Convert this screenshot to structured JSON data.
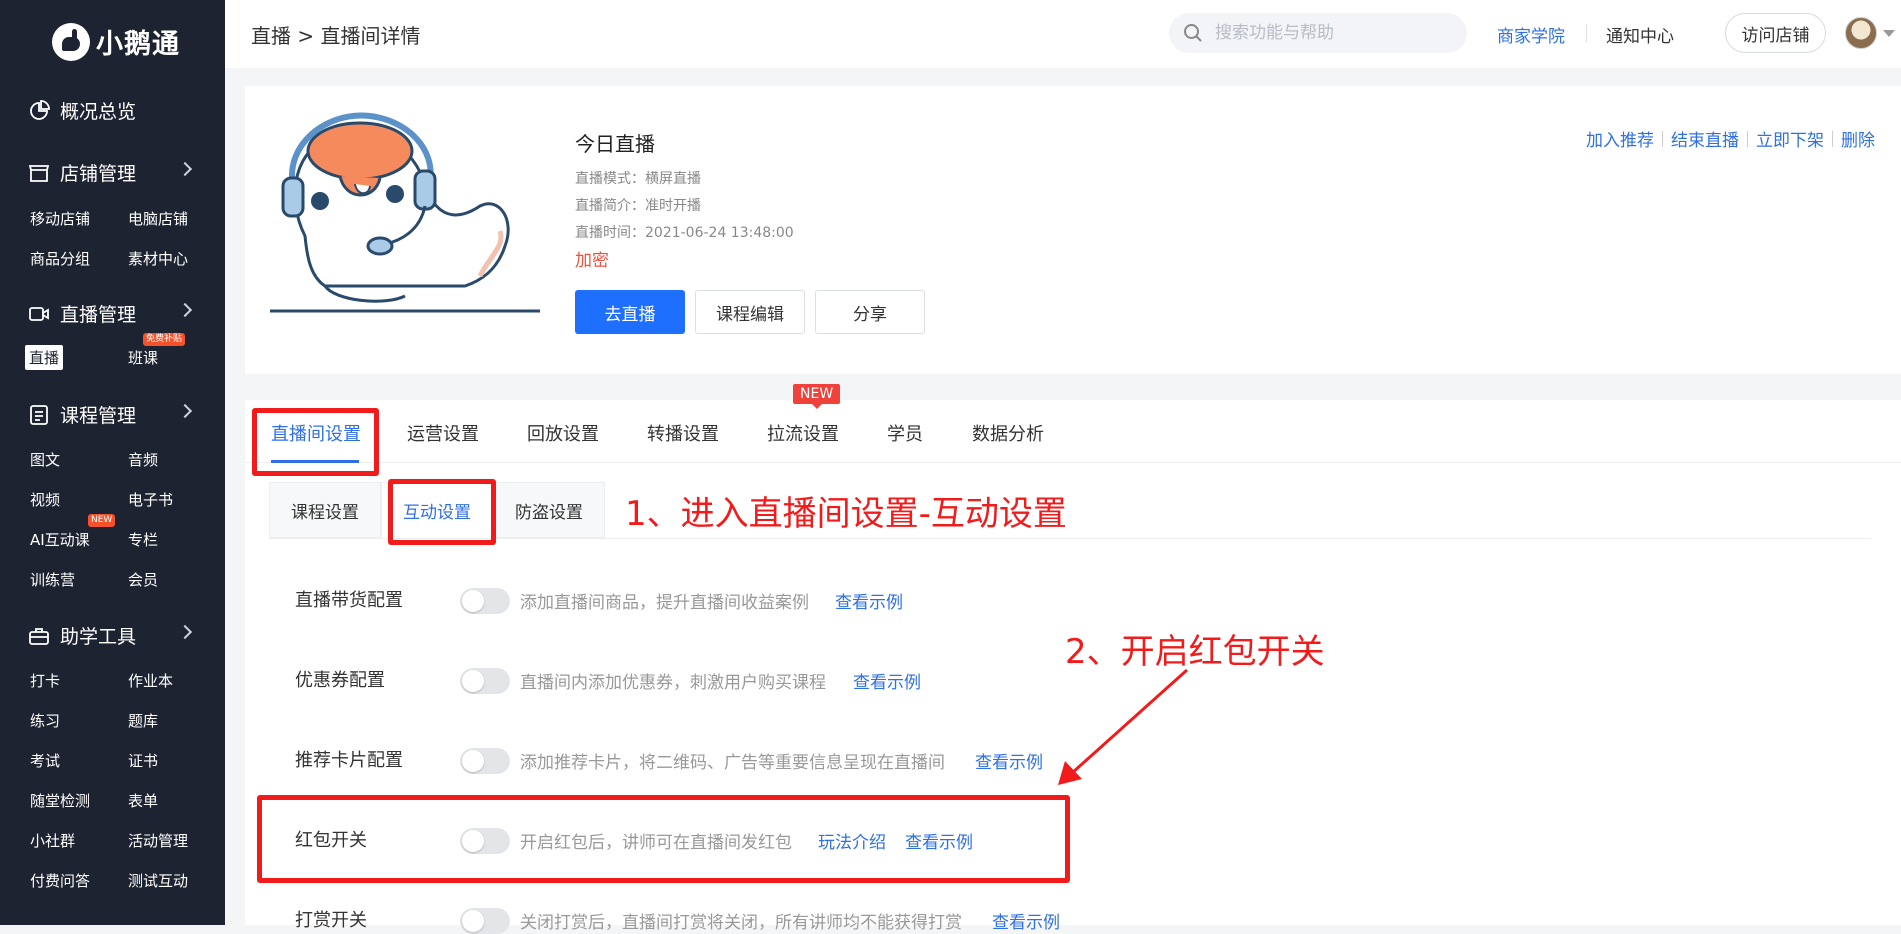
{
  "sidebar": {
    "logo_text": "小鹅通",
    "groups": [
      {
        "label": "概况总览"
      },
      {
        "label": "店铺管理",
        "items": [
          "移动店铺",
          "电脑店铺",
          "商品分组",
          "素材中心"
        ]
      },
      {
        "label": "直播管理",
        "items": [
          "直播",
          "班课"
        ],
        "badge": "免费补贴"
      },
      {
        "label": "课程管理",
        "items": [
          "图文",
          "音频",
          "视频",
          "电子书",
          "AI互动课",
          "专栏",
          "训练营",
          "会员"
        ],
        "badge": "NEW"
      },
      {
        "label": "助学工具",
        "items": [
          "打卡",
          "作业本",
          "练习",
          "题库",
          "考试",
          "证书",
          "随堂检测",
          "表单",
          "小社群",
          "活动管理",
          "付费问答",
          "测试互动"
        ]
      }
    ]
  },
  "topbar": {
    "breadcrumb": "直播 > 直播间详情",
    "search_placeholder": "搜索功能与帮助",
    "links": [
      "商家学院",
      "通知中心"
    ],
    "visit_store": "访问店铺"
  },
  "live": {
    "title": "今日直播",
    "mode": "直播模式：横屏直播",
    "intro": "直播简介：准时开播",
    "time": "直播时间：2021-06-24 13:48:00",
    "lock": "加密",
    "buttons": {
      "go_live": "去直播",
      "course_edit": "课程编辑",
      "share": "分享"
    },
    "actions": [
      "加入推荐",
      "结束直播",
      "立即下架",
      "删除"
    ]
  },
  "tabs": {
    "items": [
      "直播间设置",
      "运营设置",
      "回放设置",
      "转播设置",
      "拉流设置",
      "学员",
      "数据分析"
    ],
    "new_badge": "NEW"
  },
  "subtabs": [
    "课程设置",
    "互动设置",
    "防盗设置"
  ],
  "settings_rows": [
    {
      "label": "直播带货配置",
      "desc": "添加直播间商品，提升直播间收益案例",
      "links": [
        "查看示例"
      ]
    },
    {
      "label": "优惠券配置",
      "desc": "直播间内添加优惠券，刺激用户购买课程",
      "links": [
        "查看示例"
      ]
    },
    {
      "label": "推荐卡片配置",
      "desc": "添加推荐卡片，将二维码、广告等重要信息呈现在直播间",
      "links": [
        "查看示例"
      ]
    },
    {
      "label": "红包开关",
      "desc": "开启红包后，讲师可在直播间发红包",
      "links": [
        "玩法介绍",
        "查看示例"
      ]
    },
    {
      "label": "打赏开关",
      "desc": "关闭打赏后，直播间打赏将关闭，所有讲师均不能获得打赏",
      "links": [
        "查看示例"
      ]
    }
  ],
  "annotations": {
    "step1": "1、进入直播间设置-互动设置",
    "step2": "2、开启红包开关"
  },
  "colors": {
    "accent": "#2f6fe8",
    "sidebar_bg": "#1e2332",
    "annotation": "#f21b1b",
    "primary_button": "#1f6fff"
  }
}
